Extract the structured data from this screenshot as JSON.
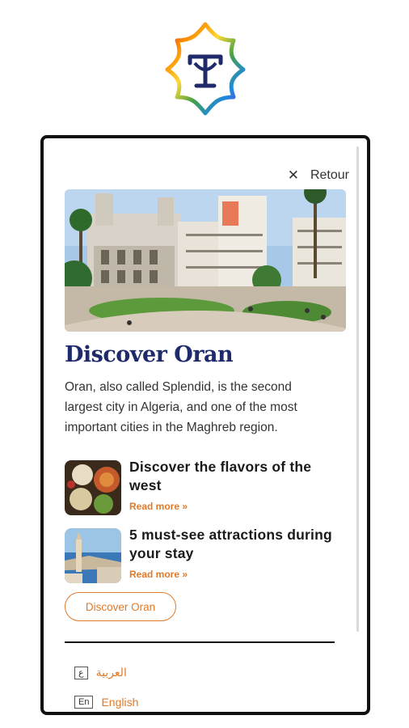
{
  "header": {
    "retour_label": "Retour"
  },
  "hero": {
    "title": "Discover Oran",
    "description": "Oran, also called Splendid, is the second largest city in Algeria, and one of the most important cities in the Maghreb region."
  },
  "articles": [
    {
      "title": "Discover the flavors of the west",
      "link": "Read more »"
    },
    {
      "title": "5 must-see attractions during your stay",
      "link": "Read more »"
    }
  ],
  "cta": {
    "label": "Discover Oran"
  },
  "languages": [
    {
      "code": "ع",
      "label": "العربية"
    },
    {
      "code": "En",
      "label": "English"
    }
  ],
  "colors": {
    "accent": "#e07a2a",
    "title": "#1f2a6b"
  }
}
